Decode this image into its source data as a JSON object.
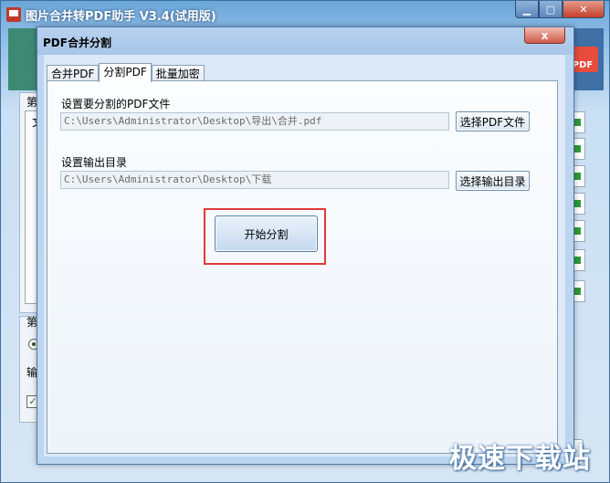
{
  "main_window": {
    "title": "图片合并转PDF助手 V3.4(试用版)",
    "logo_text": "PDF",
    "controls": {
      "minimize": "▁",
      "maximize": "□",
      "close": "✕"
    },
    "bg_labels": {
      "group1": "第",
      "list_row": "文",
      "group2": "第",
      "output": "输"
    }
  },
  "dialog": {
    "title": "PDF合并分割",
    "close_glyph": "x",
    "tabs": [
      {
        "label": "合并PDF",
        "active": false
      },
      {
        "label": "分割PDF",
        "active": true
      },
      {
        "label": "批量加密",
        "active": false
      }
    ],
    "split_pane": {
      "pdf_file_label": "设置要分割的PDF文件",
      "pdf_file_value": "C:\\Users\\Administrator\\Desktop\\导出\\合并.pdf",
      "choose_pdf_button": "选择PDF文件",
      "output_dir_label": "设置输出目录",
      "output_dir_value": "C:\\Users\\Administrator\\Desktop\\下载",
      "choose_dir_button": "选择输出目录",
      "start_button": "开始分割"
    }
  },
  "watermark": "极速下载站",
  "colors": {
    "highlight": "#e03a3a",
    "dialog_bg": "#dde9f6"
  }
}
